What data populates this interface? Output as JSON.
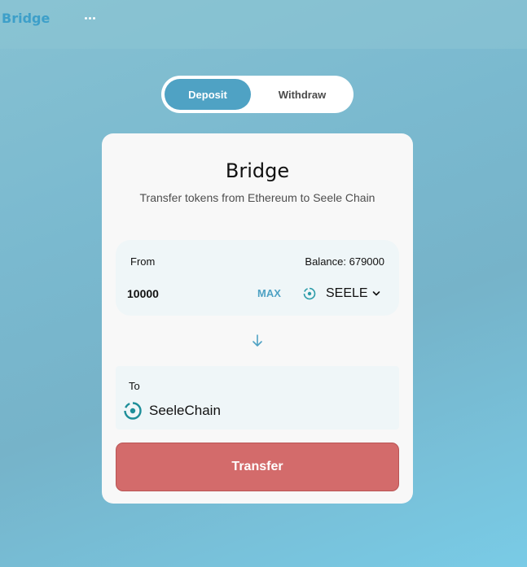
{
  "header": {
    "brand": "Bridge",
    "menu_icon": "more-horizontal-icon"
  },
  "mode_toggle": {
    "tabs": [
      {
        "label": "Deposit",
        "selected": true
      },
      {
        "label": "Withdraw",
        "selected": false
      }
    ]
  },
  "card": {
    "title": "Bridge",
    "subtitle": "Transfer tokens from Ethereum to Seele Chain",
    "from": {
      "label": "From",
      "balance": "Balance: 679000",
      "amount": "10000",
      "max_label": "MAX",
      "token": {
        "name": "SEELE",
        "icon": "seele-logo-icon"
      }
    },
    "direction_icon": "arrow-down-icon",
    "to": {
      "label": "To",
      "chain": {
        "name": "SeeleChain",
        "icon": "seelechain-logo-icon"
      }
    },
    "transfer_label": "Transfer"
  },
  "colors": {
    "accent": "#4fa2c4",
    "transfer_button": "#d36b6b",
    "card_background": "#f8f8f8",
    "field_background": "#eff6f8"
  }
}
